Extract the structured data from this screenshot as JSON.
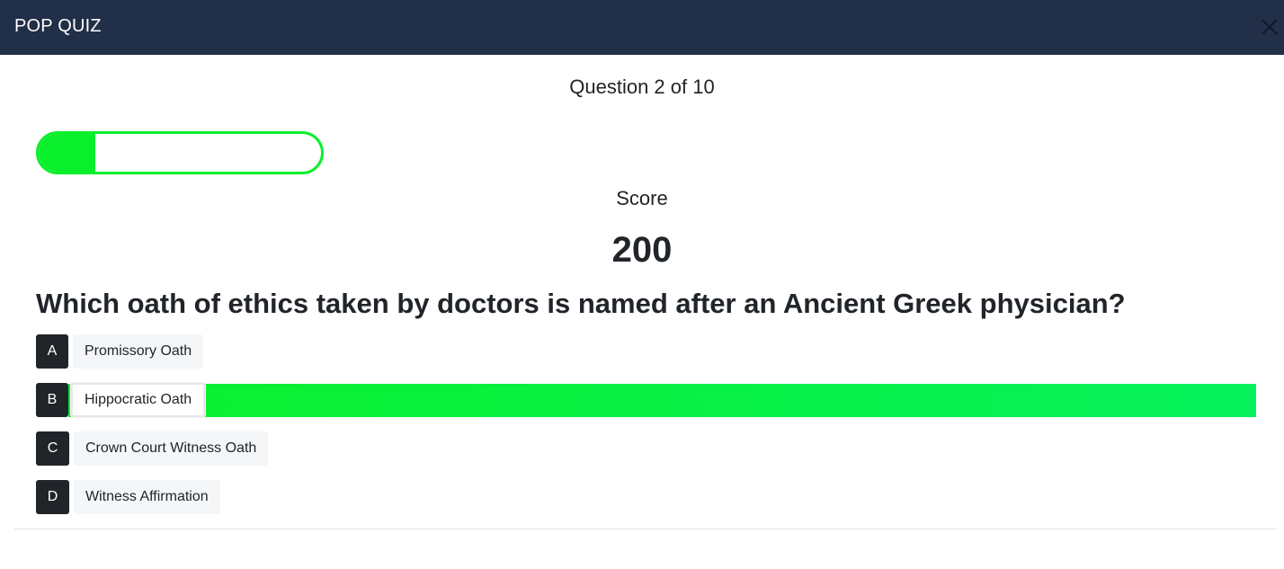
{
  "header": {
    "title": "POP QUIZ",
    "close_icon": "close-icon",
    "background_color": "#222f49"
  },
  "progress": {
    "counter_text": "Question 2 of 10",
    "current": 2,
    "total": 10,
    "fraction": 0.2,
    "color": "#0aef2c"
  },
  "score": {
    "label": "Score",
    "value": "200"
  },
  "question": {
    "text": "Which oath of ethics taken by doctors is named after an Ancient Greek physician?",
    "answers": [
      {
        "letter": "A",
        "text": "Promissory Oath",
        "correct": false
      },
      {
        "letter": "B",
        "text": "Hippocratic Oath",
        "correct": true
      },
      {
        "letter": "C",
        "text": "Crown Court Witness Oath",
        "correct": false
      },
      {
        "letter": "D",
        "text": "Witness Affirmation",
        "correct": false
      }
    ]
  }
}
